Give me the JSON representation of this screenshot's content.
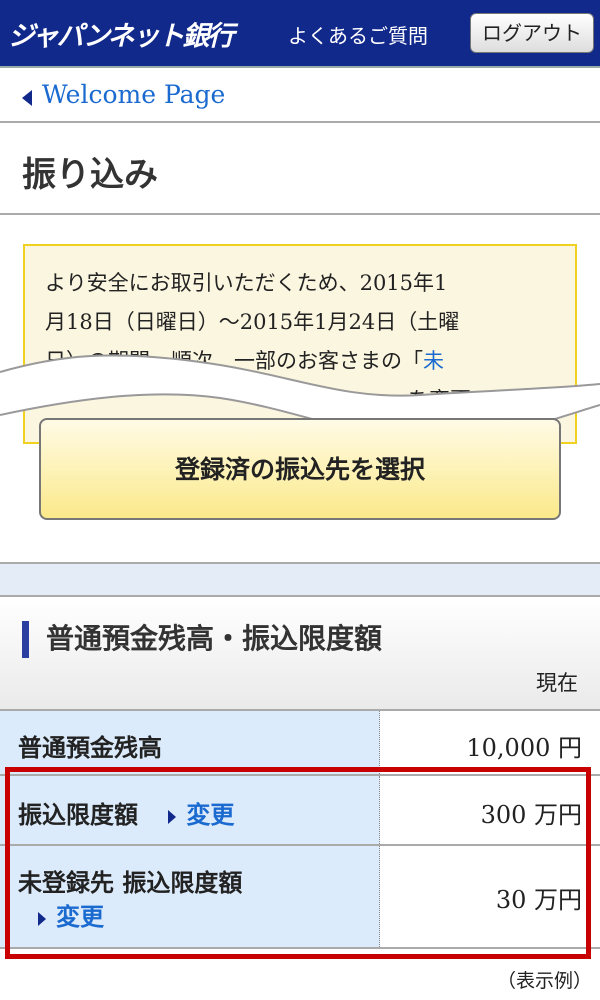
{
  "header": {
    "logo": "ジャパンネット銀行",
    "faq": "よくあるご質問",
    "logout": "ログアウト"
  },
  "back_link": "Welcome Page",
  "page_title": "振り込み",
  "notice": {
    "lines": [
      "より安全にお取引いただくため、2015年1",
      "月18日（日曜日）〜2015年1月24日（土曜",
      "日）の期間、順次、一部のお客さまの「",
      "を変更いたしま"
    ],
    "link": "未"
  },
  "select_button": "登録済の振込先を選択",
  "section": {
    "title": "普通預金残高・振込限度額",
    "as_of": "現在",
    "rows": [
      {
        "label": "普通預金残高",
        "value": "10,000 円"
      },
      {
        "label": "振込限度額",
        "change": "変更",
        "value": "300 万円"
      },
      {
        "label": "未登録先 振込限度額",
        "change": "変更",
        "value": "30 万円"
      }
    ]
  },
  "caption": "（表示例）",
  "colors": {
    "header": "#12298c",
    "link": "#1a6ad0",
    "highlight": "#c80000"
  }
}
